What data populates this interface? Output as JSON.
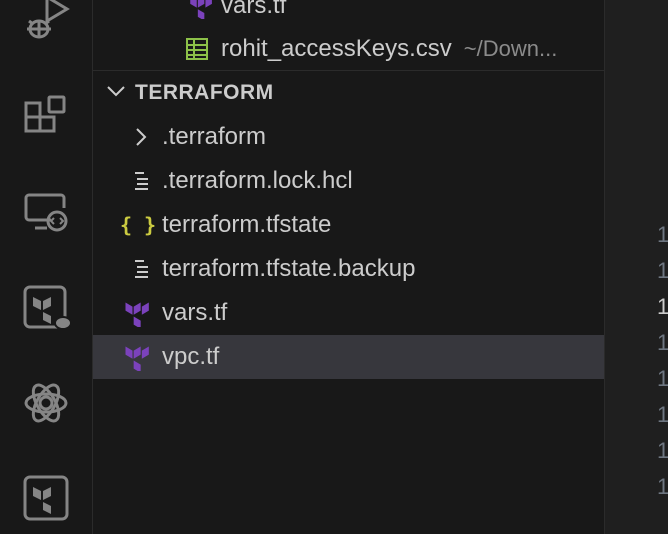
{
  "activity_bar": {
    "icons": [
      "run-debug-icon",
      "extensions-icon",
      "remote-explorer-icon",
      "terraform-cloud-icon",
      "openai-icon",
      "terraform-icon"
    ]
  },
  "explorer": {
    "top_files": [
      {
        "label": "vars.tf",
        "icon": "terraform-file-icon"
      },
      {
        "label": "rohit_accessKeys.csv",
        "description": "~/Down...",
        "icon": "csv-file-icon"
      }
    ],
    "section_title": "TERRAFORM",
    "items": [
      {
        "label": ".terraform",
        "icon": "chevron-right-icon",
        "type": "folder"
      },
      {
        "label": ".terraform.lock.hcl",
        "icon": "lines-file-icon"
      },
      {
        "label": "terraform.tfstate",
        "icon": "json-braces-icon"
      },
      {
        "label": "terraform.tfstate.backup",
        "icon": "lines-file-icon"
      },
      {
        "label": "vars.tf",
        "icon": "terraform-file-icon"
      },
      {
        "label": "vpc.tf",
        "icon": "terraform-file-icon",
        "selected": true
      }
    ]
  },
  "editor": {
    "line_numbers": [
      "1",
      "1",
      "1",
      "1",
      "1",
      "1",
      "1",
      "1"
    ]
  },
  "colors": {
    "terraform_purple": "#7b42bc",
    "json_yellow": "#cbcb41",
    "csv_green": "#8dc149",
    "selected_bg": "#37373d"
  }
}
